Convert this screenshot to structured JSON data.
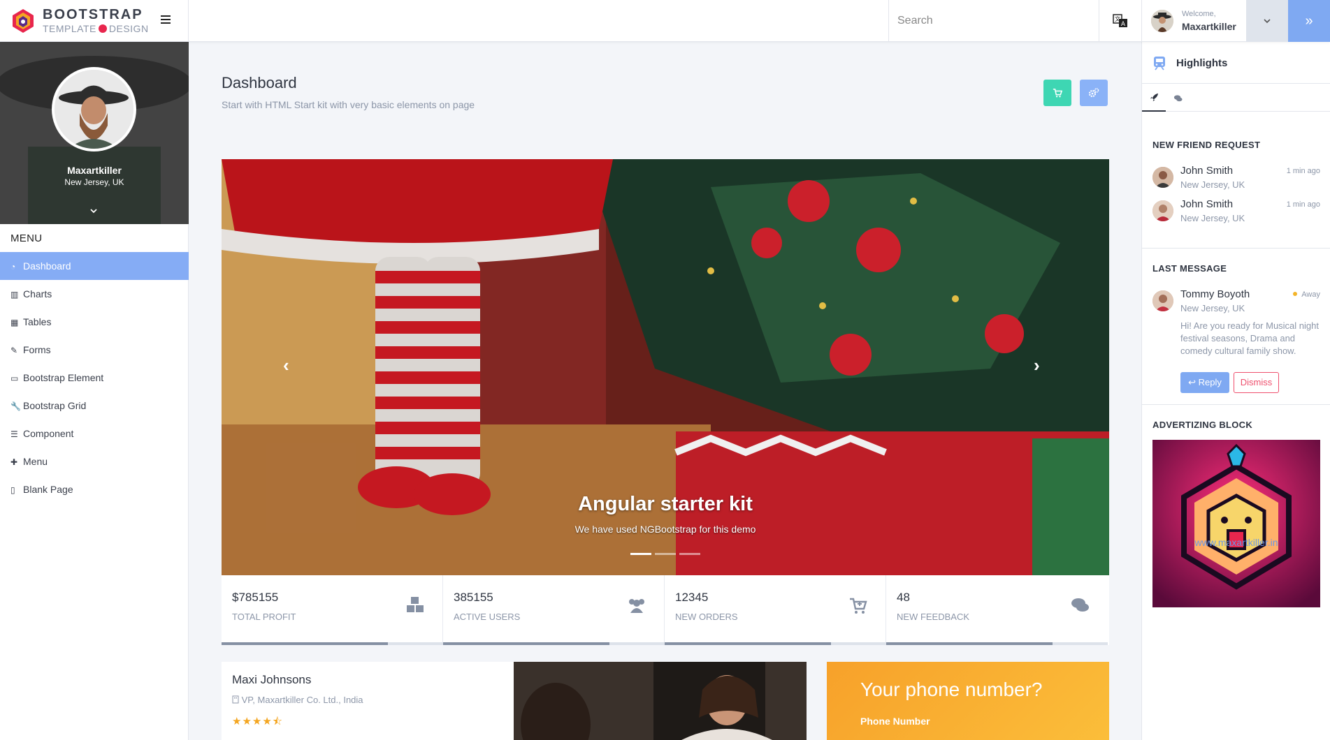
{
  "brand": {
    "name": "BOOTSTRAP",
    "sub_left": "TEMPLATE",
    "sub_right": "DESIGN"
  },
  "header": {
    "search_placeholder": "Search",
    "welcome": "Welcome,",
    "user_name": "Maxartkiller",
    "panel_toggle": "»"
  },
  "profile": {
    "name": "Maxartkiller",
    "location": "New Jersey, UK"
  },
  "menu": {
    "title": "MENU",
    "items": [
      {
        "label": "Dashboard",
        "icon": "dashboard-icon",
        "glyph": "◔"
      },
      {
        "label": "Charts",
        "icon": "bar-chart-icon",
        "glyph": "▥"
      },
      {
        "label": "Tables",
        "icon": "table-icon",
        "glyph": "▦"
      },
      {
        "label": "Forms",
        "icon": "edit-icon",
        "glyph": "✎"
      },
      {
        "label": "Bootstrap Element",
        "icon": "desktop-icon",
        "glyph": "▭"
      },
      {
        "label": "Bootstrap Grid",
        "icon": "wrench-icon",
        "glyph": "🔧"
      },
      {
        "label": "Component",
        "icon": "list-icon",
        "glyph": "☰"
      },
      {
        "label": "Menu",
        "icon": "plus-icon",
        "glyph": "✚"
      },
      {
        "label": "Blank Page",
        "icon": "file-icon",
        "glyph": "▯"
      }
    ]
  },
  "page": {
    "title": "Dashboard",
    "subtitle": "Start with HTML Start kit with very basic elements on page"
  },
  "carousel": {
    "title": "Angular starter kit",
    "caption": "We have used NGBootstrap for this demo",
    "prev": "‹",
    "next": "›"
  },
  "stats": [
    {
      "value": "$785155",
      "label": "TOTAL PROFIT",
      "icon": "cubes-icon",
      "progress": 0.75
    },
    {
      "value": "385155",
      "label": "ACTIVE USERS",
      "icon": "users-icon",
      "progress": 0.75
    },
    {
      "value": "12345",
      "label": "NEW ORDERS",
      "icon": "cart-plus-icon",
      "progress": 0.75
    },
    {
      "value": "48",
      "label": "NEW FEEDBACK",
      "icon": "comments-icon",
      "progress": 0.75
    }
  ],
  "person_card": {
    "name": "Maxi Johnsons",
    "title": "VP, Maxartkiller Co. Ltd., India",
    "stars": "★★★★⯪",
    "rating": 4.5
  },
  "phone_card": {
    "title": "Your phone number?",
    "label": "Phone Number"
  },
  "right_panel": {
    "title": "Highlights",
    "friend_requests_title": "NEW FRIEND REQUEST",
    "friend_requests": [
      {
        "name": "John Smith",
        "location": "New Jersey, UK",
        "time": "1 min ago"
      },
      {
        "name": "John Smith",
        "location": "New Jersey, UK",
        "time": "1 min ago"
      }
    ],
    "last_message_title": "LAST MESSAGE",
    "last_message": {
      "name": "Tommy Boyoth",
      "location": "New Jersey, UK",
      "status": "Away",
      "text": "Hi! Are you ready for Musical night festival seasons, Drama and comedy cultural family show.",
      "reply_label": "Reply",
      "dismiss_label": "Dismiss"
    },
    "ad_title": "ADVERTIZING BLOCK",
    "ad_link": "www.maxartkiller.in"
  },
  "colors": {
    "accent": "#85acf5",
    "teal": "#3ed6b3",
    "danger": "#ef4f6d",
    "star": "#f4a621",
    "phone_card": "#f7a12a"
  }
}
